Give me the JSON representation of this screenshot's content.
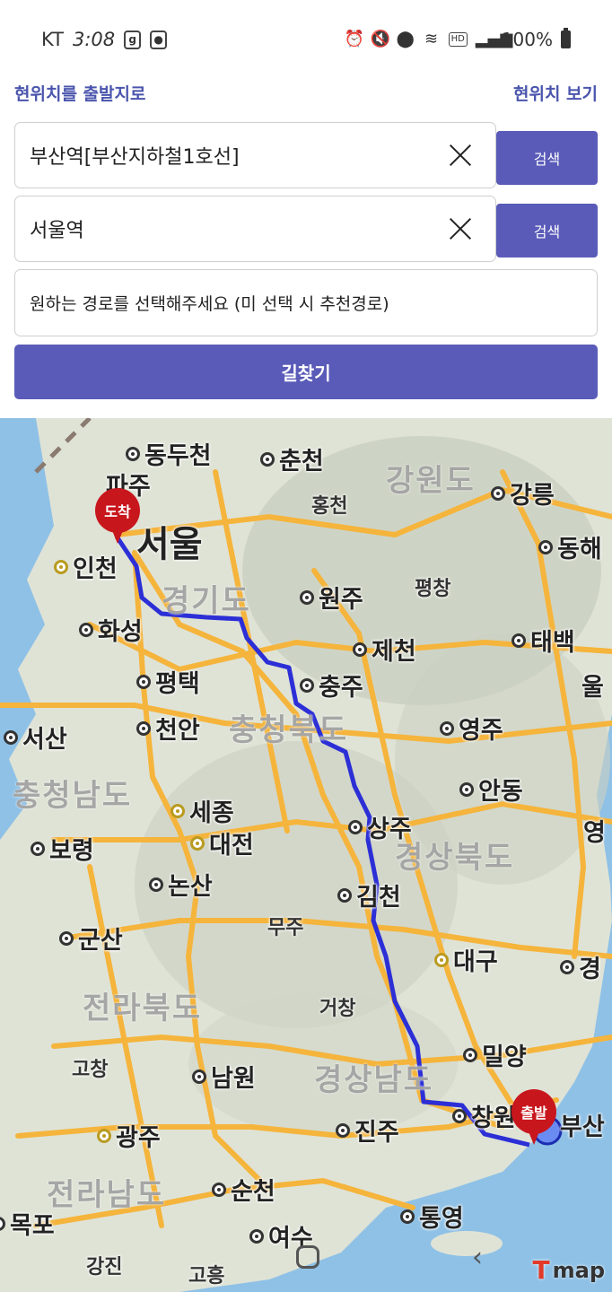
{
  "status_bar": {
    "carrier": "KT",
    "time": "3:08",
    "hd": "HD",
    "battery": "100%"
  },
  "links": {
    "use_current_as_start": "현위치를 출발지로",
    "view_current": "현위치 보기"
  },
  "origin": {
    "value": "부산역[부산지하철1호선]",
    "search_label": "검색"
  },
  "destination": {
    "value": "서울역",
    "search_label": "검색"
  },
  "route_select": {
    "placeholder": "원하는 경로를 선택해주세요 (미 선택 시 추천경로)"
  },
  "go_button": "길찾기",
  "map": {
    "start_marker": "출발",
    "end_marker": "도착",
    "capital": "서울",
    "brand": "map",
    "regions": [
      "강원도",
      "경기도",
      "충청북도",
      "충청남도",
      "경상북도",
      "전라북도",
      "경상남도",
      "전라남도"
    ],
    "cities": [
      "동두천",
      "춘천",
      "파주",
      "인천",
      "강릉",
      "동해",
      "원주",
      "화성",
      "제천",
      "태백",
      "평택",
      "충주",
      "천안",
      "서산",
      "영주",
      "안동",
      "세종",
      "대전",
      "상주",
      "보령",
      "논산",
      "김천",
      "군산",
      "대구",
      "경",
      "고창",
      "밀양",
      "남원",
      "광주",
      "진주",
      "창원",
      "부산",
      "순천",
      "통영",
      "목포",
      "여수",
      "강진",
      "고흥",
      "영",
      "울"
    ],
    "towns": [
      "홍천",
      "평창",
      "무주",
      "거창"
    ]
  }
}
